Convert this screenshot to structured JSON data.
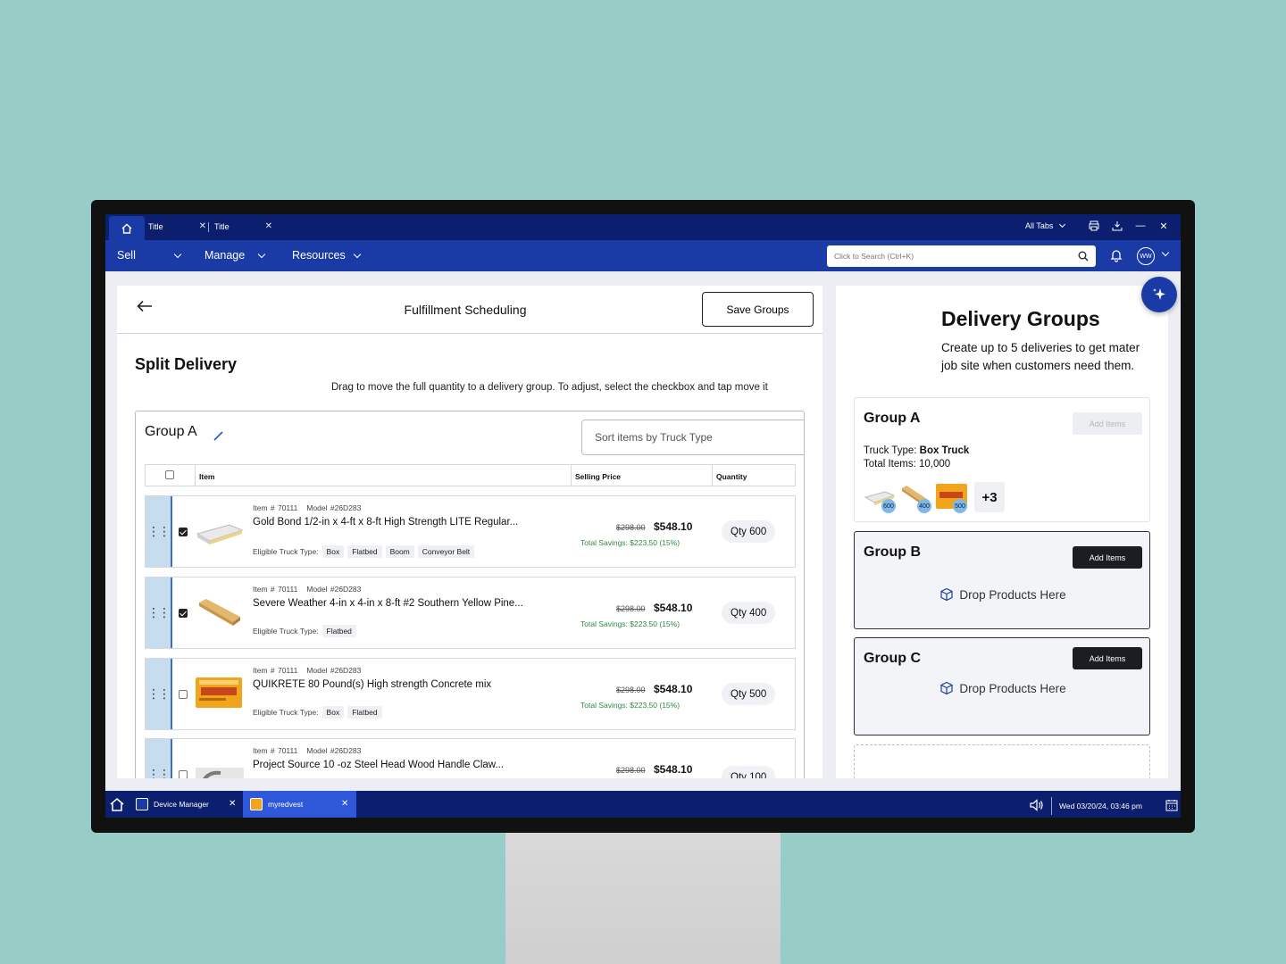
{
  "tabs": [
    {
      "label": "Title"
    },
    {
      "label": "Title"
    }
  ],
  "all_tabs_label": "All Tabs",
  "nav": {
    "items": [
      {
        "label": "Sell"
      },
      {
        "label": "Manage"
      },
      {
        "label": "Resources"
      }
    ],
    "search_placeholder": "Click to Search (Ctrl+K)",
    "avatar_initials": "WW"
  },
  "fulfillment": {
    "page_title": "Fulfillment Scheduling",
    "save_label": "Save Groups",
    "section_title": "Split Delivery",
    "instructions": "Drag to move the full quantity to a delivery group. To adjust, select the checkbox and tap move it",
    "group_name": "Group A",
    "sort_placeholder": "Sort items by Truck Type",
    "columns": {
      "item": "Item",
      "price": "Selling Price",
      "quantity": "Quantity"
    },
    "eligible_label": "Eligible Truck Type:",
    "rows": [
      {
        "item_no": "Item # 70111",
        "model": "Model #26D283",
        "name": "Gold Bond 1/2-in x 4-ft x 8-ft High Strength LITE Regular...",
        "trucks": [
          "Box",
          "Flatbed",
          "Boom",
          "Conveyor Belt"
        ],
        "old_price": "$298.00",
        "price": "$548.10",
        "savings": "Total Savings: $223.50 (15%)",
        "qty": "Qty 600",
        "checked": true,
        "thumb": "drywall"
      },
      {
        "item_no": "Item # 70111",
        "model": "Model #26D283",
        "name": "Severe Weather 4-in x 4-in x 8-ft #2 Southern Yellow Pine...",
        "trucks": [
          "Flatbed"
        ],
        "old_price": "$298.00",
        "price": "$548.10",
        "savings": "Total Savings: $223.50 (15%)",
        "qty": "Qty 400",
        "checked": true,
        "thumb": "lumber"
      },
      {
        "item_no": "Item # 70111",
        "model": "Model #26D283",
        "name": "QUIKRETE 80 Pound(s) High strength Concrete mix",
        "trucks": [
          "Box",
          "Flatbed"
        ],
        "old_price": "$298.00",
        "price": "$548.10",
        "savings": "Total Savings: $223.50 (15%)",
        "qty": "Qty 500",
        "checked": false,
        "thumb": "concrete"
      },
      {
        "item_no": "Item # 70111",
        "model": "Model #26D283",
        "name": "Project Source 10 -oz Steel Head Wood Handle Claw...",
        "trucks": [],
        "old_price": "$298.00",
        "price": "$548.10",
        "savings": "",
        "qty": "Qty 100",
        "checked": false,
        "thumb": "hammer"
      }
    ]
  },
  "delivery_groups": {
    "title": "Delivery Groups",
    "description_line1": "Create up to 5 deliveries to get mater",
    "description_line2": "job site when customers need them.",
    "group_a": {
      "name": "Group A",
      "add_label": "Add Items",
      "truck_label": "Truck Type:",
      "truck_value": "Box Truck",
      "total_label": "Total Items: 10,000",
      "thumbs": [
        {
          "kind": "drywall",
          "count": "600"
        },
        {
          "kind": "lumber",
          "count": "400"
        },
        {
          "kind": "concrete",
          "count": "500"
        }
      ],
      "more": "+3"
    },
    "group_b": {
      "name": "Group B",
      "add_label": "Add Items",
      "drop_label": "Drop Products Here"
    },
    "group_c": {
      "name": "Group C",
      "add_label": "Add Items",
      "drop_label": "Drop Products Here"
    }
  },
  "taskbar": {
    "items": [
      {
        "label": "Device Manager"
      },
      {
        "label": "myredvest"
      }
    ],
    "datetime": "Wed 03/20/24, 03:46 pm"
  },
  "colors": {
    "background": "#97cdc6",
    "navy": "#0b1f6e",
    "nav_blue": "#1a3aa6",
    "savings_green": "#2c8a3f",
    "drag_highlight": "#c8dcf0"
  }
}
